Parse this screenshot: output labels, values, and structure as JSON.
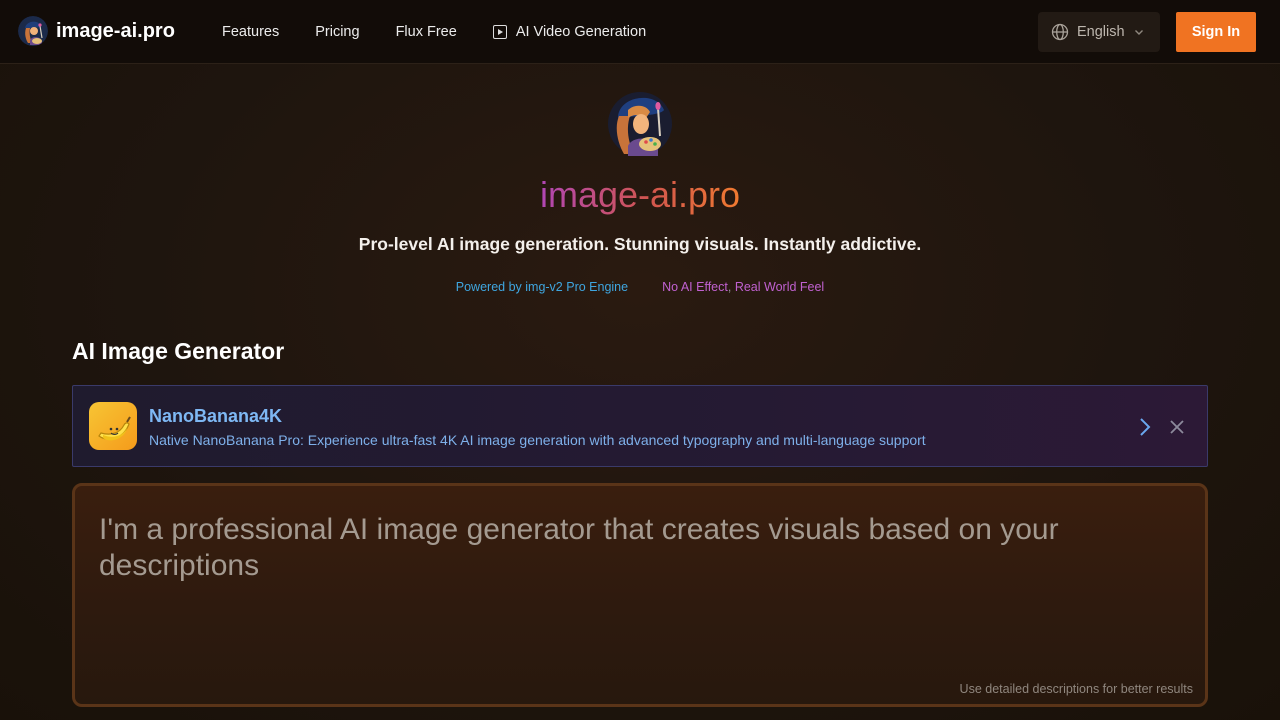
{
  "header": {
    "brand_name": "image-ai.pro",
    "nav": [
      {
        "label": "Features"
      },
      {
        "label": "Pricing"
      },
      {
        "label": "Flux Free"
      },
      {
        "label": "AI Video Generation",
        "icon": "play-square-icon"
      }
    ],
    "language": "English",
    "sign_in_label": "Sign In"
  },
  "hero": {
    "title": "image-ai.pro",
    "tagline": "Pro-level AI image generation. Stunning visuals. Instantly addictive.",
    "badge_left": "Powered by img-v2 Pro Engine",
    "badge_right_a": "No AI Effect",
    "badge_right_sep": ",",
    "badge_right_b": "Real World Feel"
  },
  "generator": {
    "section_title": "AI Image Generator",
    "promo": {
      "title": "NanoBanana4K",
      "description": "Native NanoBanana Pro: Experience ultra-fast 4K AI image generation with advanced typography and multi-language support"
    },
    "prompt_placeholder": "I'm a professional AI image generator that creates visuals based on your descriptions",
    "hint": "Use detailed descriptions for better results"
  },
  "colors": {
    "accent": "#f07322",
    "promo_text": "#7eb8f4",
    "badge_blue": "#3fa6e0",
    "badge_purple": "#c061d0"
  }
}
